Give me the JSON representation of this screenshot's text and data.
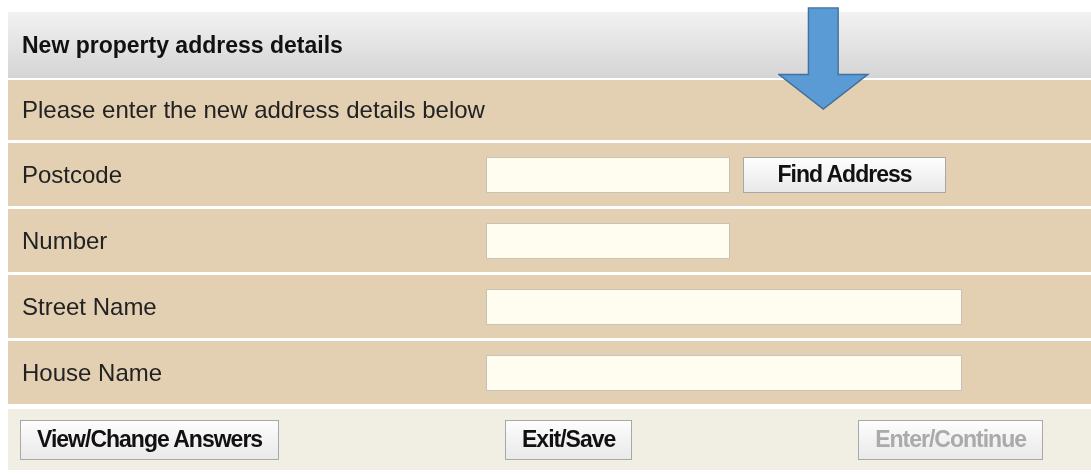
{
  "panel": {
    "title": "New property address details",
    "intro": "Please enter the new address details below"
  },
  "fields": [
    {
      "label": "Postcode",
      "kind": "short",
      "button": "Find Address"
    },
    {
      "label": "Number",
      "kind": "short"
    },
    {
      "label": "Street Name",
      "kind": "long"
    },
    {
      "label": "House Name",
      "kind": "long"
    }
  ],
  "buttons": [
    {
      "label": "View/Change Answers",
      "disabled": false
    },
    {
      "label": "Exit/Save",
      "disabled": false
    },
    {
      "label": "Enter/Continue",
      "disabled": true
    }
  ]
}
